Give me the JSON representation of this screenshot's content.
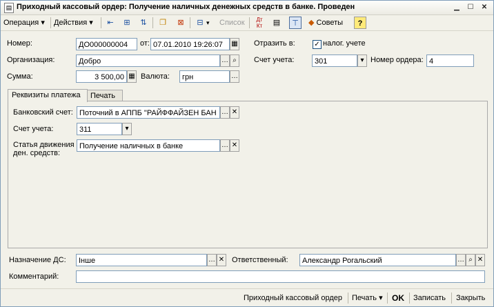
{
  "window": {
    "title": "Приходный кассовый ордер: Получение наличных денежных средств в банке. Проведен",
    "icons": [
      "document-icon",
      "minimize-icon",
      "maximize-icon",
      "close-icon"
    ]
  },
  "toolbar": {
    "operation_label": "Операция",
    "actions_label": "Действия",
    "list_label": "Список",
    "tips_label": "Советы",
    "help_label": "?",
    "dt_kt_label": "Дт Кт"
  },
  "form": {
    "number_label": "Номер:",
    "number_value": "ДО000000004",
    "from_label": "от:",
    "date_value": "07.01.2010 19:26:07",
    "reflect_label": "Отразить в:",
    "tax_accounting_label": "налог. учете",
    "tax_accounting_checked": true,
    "organization_label": "Организация:",
    "organization_value": "Добро",
    "account_label": "Счет учета:",
    "account_value": "301",
    "order_number_label": "Номер ордера:",
    "order_number_value": "4",
    "sum_label": "Сумма:",
    "sum_value": "3 500,00",
    "currency_label": "Валюта:",
    "currency_value": "грн"
  },
  "tabs": [
    {
      "label": "Реквизиты платежа",
      "active": true
    },
    {
      "label": "Печать",
      "active": false
    }
  ],
  "payment": {
    "bank_account_label": "Банковский счет:",
    "bank_account_value": "Поточний в АППБ \"РАЙФФАЙЗЕН БАН",
    "account_label": "Счет учета:",
    "account_value": "311",
    "cashflow_label_1": "Статья движения",
    "cashflow_label_2": "ден. средств:",
    "cashflow_value": "Получение наличных в банке"
  },
  "footer_fields": {
    "purpose_label": "Назначение ДС:",
    "purpose_value": "Інше",
    "responsible_label": "Ответственный:",
    "responsible_value": "Александр Рогальский",
    "comment_label": "Комментарий:",
    "comment_value": ""
  },
  "bottombar": {
    "incoming_order_label": "Приходный кассовый ордер",
    "print_label": "Печать",
    "ok_label": "OK",
    "save_label": "Записать",
    "close_label": "Закрыть"
  }
}
